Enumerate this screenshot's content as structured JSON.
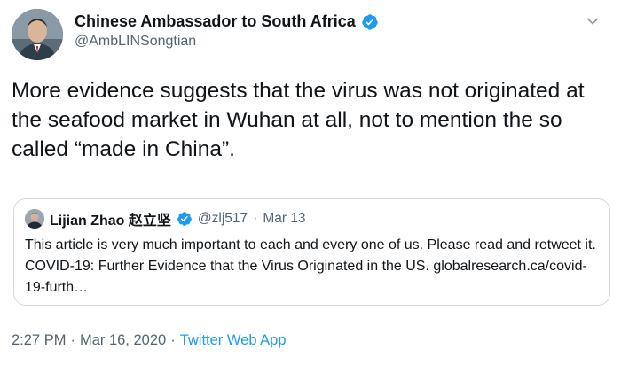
{
  "author": {
    "display_name": "Chinese Ambassador to South Africa",
    "handle": "@AmbLINSongtian",
    "verified": true
  },
  "tweet": {
    "text": "More evidence suggests that the virus was not originated at the seafood market in Wuhan at all, not to mention the so called “made in China”."
  },
  "quoted": {
    "display_name": "Lijian Zhao 赵立坚",
    "handle": "@zlj517",
    "separator": "·",
    "date": "Mar 13",
    "text": "This article is very much important to each and every one of us. Please read and retweet it. COVID-19: Further Evidence that the Virus Originated in the US. globalresearch.ca/covid-19-furth…"
  },
  "footer": {
    "time": "2:27 PM",
    "separator1": "·",
    "date": "Mar 16, 2020",
    "separator2": "·",
    "app": "Twitter Web App"
  },
  "colors": {
    "verified_blue": "#1d9bf0",
    "secondary_text": "#536471",
    "link": "#1d9bf0",
    "border": "#cfd9de"
  },
  "icons": {
    "verified": "verified-badge-icon",
    "caret": "chevron-down-icon"
  }
}
